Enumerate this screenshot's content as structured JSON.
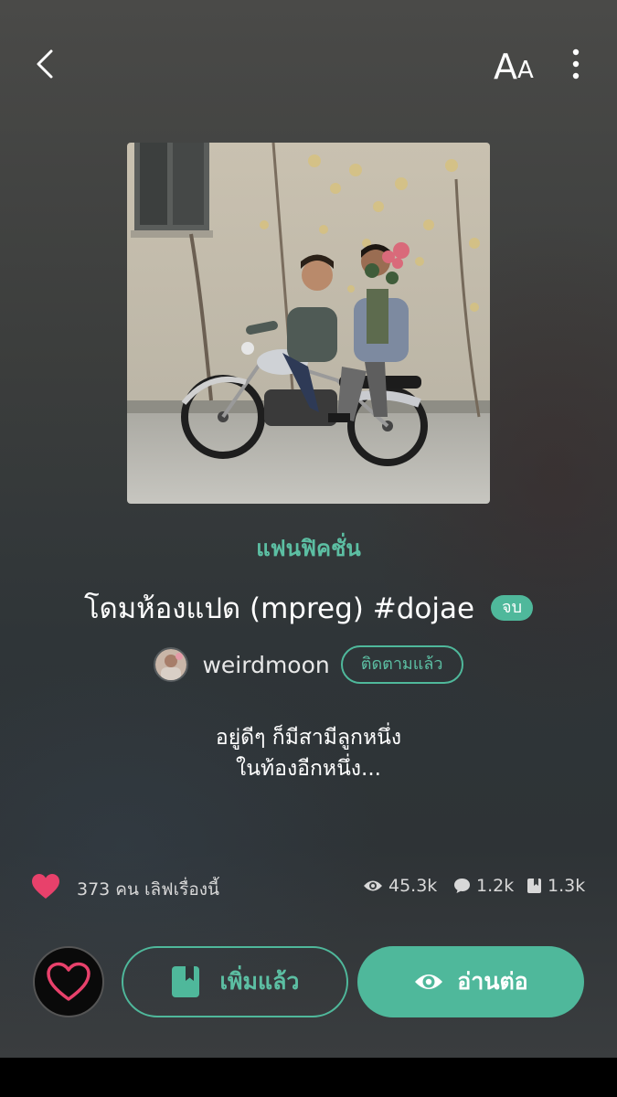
{
  "header": {
    "font_label_big": "A",
    "font_label_small": "A"
  },
  "story": {
    "category": "แฟนฟิคชั่น",
    "title": "โดมห้องแปด (mpreg) #dojae",
    "status": "จบ",
    "author": "weirdmoon",
    "follow_label": "ติดตามแล้ว",
    "synopsis_line1": "อยู่ดีๆ ก็มีสามีลูกหนึ่ง",
    "synopsis_line2": "ในท้องอีกหนึ่ง..."
  },
  "stats": {
    "love_text": "373 คน เลิฟเรื่องนี้",
    "views": "45.3k",
    "comments": "1.2k",
    "library": "1.3k"
  },
  "actions": {
    "library_label": "เพิ่มแล้ว",
    "read_label": "อ่านต่อ"
  },
  "colors": {
    "accent": "#4fb89b",
    "heart": "#e8416b"
  },
  "icons": [
    "back-arrow-icon",
    "font-size-icon",
    "more-vertical-icon",
    "heart-icon",
    "eye-icon",
    "comment-icon",
    "bookmark-book-icon"
  ]
}
